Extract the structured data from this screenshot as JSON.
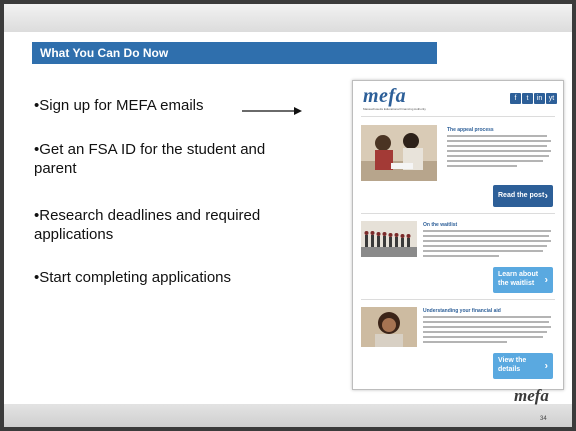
{
  "title": "What You Can Do Now",
  "bullets": [
    "•Sign up for MEFA emails",
    "•Get an FSA ID for the student and parent",
    "•Research deadlines and required applications",
    "•Start completing applications"
  ],
  "newsletter": {
    "logo": "mefa",
    "tagline": "Massachusetts Educational Financing Authority",
    "social": [
      "f",
      "t",
      "in",
      "yt"
    ],
    "sections": [
      {
        "heading": "The appeal process",
        "button": "Read the post"
      },
      {
        "heading": "On the waitlist",
        "button_line1": "Learn about",
        "button_line2": "the waitlist"
      },
      {
        "heading": "Understanding your financial aid",
        "button_line1": "View the",
        "button_line2": "details"
      }
    ]
  },
  "footer": {
    "logo": "mefa",
    "page_number": "34"
  },
  "colors": {
    "title_bar": "#2f6fad",
    "brand_blue": "#2d5f98",
    "button_dark": "#2d5f98",
    "button_light": "#5aa9e0"
  }
}
